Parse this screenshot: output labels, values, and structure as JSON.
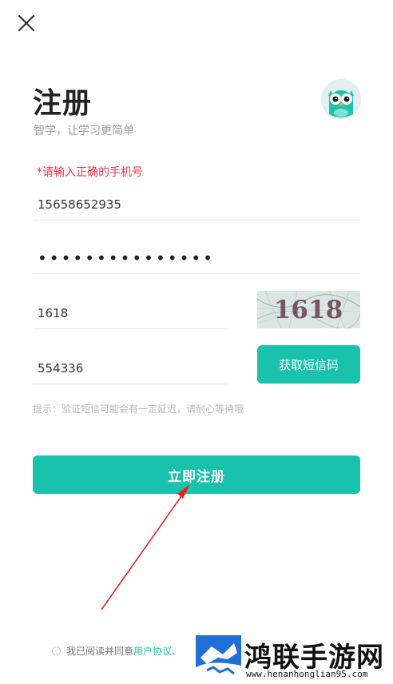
{
  "header": {
    "title": "注册",
    "subtitle": "智学，让学习更简单"
  },
  "form": {
    "error": "*请输入正确的手机号",
    "phone_value": "15658652935",
    "password_masked": "•••••••••••••••",
    "captcha_value": "1618",
    "captcha_image_text": "1618",
    "sms_code_value": "554336",
    "sms_button_label": "获取短信码",
    "hint": "提示：验证短信可能会有一定延迟，请耐心等待哦",
    "register_button_label": "立即注册"
  },
  "agreement": {
    "prefix": "我已阅读并同意",
    "link": "用户协议、"
  },
  "watermark": {
    "brand": "鸿联手游网",
    "url": "www.henanhonglian95.com"
  },
  "colors": {
    "accent": "#18c2ad",
    "error": "#e8384f",
    "annotation_arrow": "#e52222"
  },
  "icons": {
    "close": "close-icon",
    "avatar": "owl-avatar-icon",
    "watermark": "watermark-logo"
  }
}
